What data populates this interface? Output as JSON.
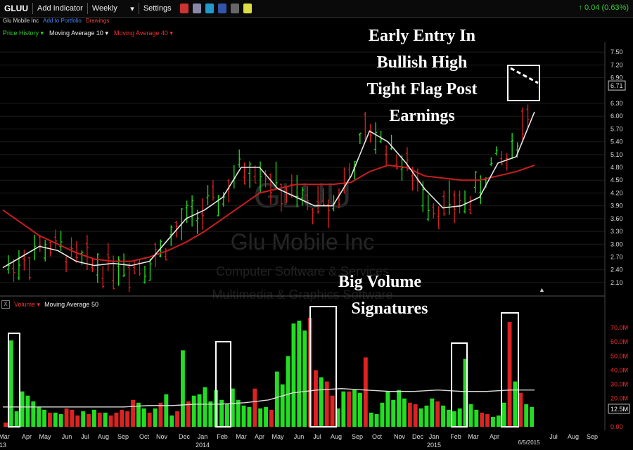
{
  "toolbar": {
    "symbol": "GLUU",
    "add_indicator": "Add Indicator",
    "period": "Weekly",
    "settings": "Settings",
    "change": "0.04 (0.63%)",
    "up_arrow": "↑"
  },
  "subbar": {
    "company": "Glu Mobile Inc",
    "add_portfolio": "Add to Portfolio",
    "drawings": "Drawings"
  },
  "price_legend": {
    "price_history": "Price History",
    "ma10": "Moving Average 10",
    "ma40": "Moving Average 40"
  },
  "volume_legend": {
    "close": "X",
    "volume": "Volume",
    "ma50": "Moving Average 50"
  },
  "watermark": {
    "symbol": "GLUU",
    "name": "Glu Mobile Inc",
    "sector": "Computer Software & Services",
    "industry": "Multimedia & Graphics Software"
  },
  "annotations": {
    "entry_line1": "Early Entry In",
    "entry_line2": "Bullish High",
    "entry_line3": "Tight Flag Post",
    "entry_line4": "Earnings",
    "volume_line1": "Big Volume",
    "volume_line2": "Signatures"
  },
  "colors": {
    "up": "#22dd22",
    "down": "#dd2222",
    "ma10": "#e6e6e6",
    "ma40": "#c81e1e",
    "accent_green": "#33cc33"
  },
  "chart_data": [
    {
      "type": "line",
      "title": "",
      "series": [
        {
          "name": "Moving Average 10",
          "values": [
            2.45,
            2.7,
            2.95,
            2.85,
            2.6,
            2.5,
            2.55,
            2.5,
            2.6,
            3.1,
            3.6,
            3.8,
            4.1,
            4.8,
            4.8,
            4.3,
            4.1,
            3.9,
            3.9,
            4.6,
            5.65,
            5.4,
            4.9,
            4.3,
            3.85,
            3.9,
            4.1,
            4.9,
            5.05,
            6.1
          ]
        },
        {
          "name": "Moving Average 40",
          "values": [
            3.8,
            3.5,
            3.2,
            3.0,
            2.8,
            2.65,
            2.6,
            2.6,
            2.7,
            2.85,
            3.05,
            3.3,
            3.6,
            3.9,
            4.2,
            4.3,
            4.4,
            4.4,
            4.4,
            4.45,
            4.7,
            4.85,
            4.8,
            4.6,
            4.55,
            4.5,
            4.5,
            4.6,
            4.7,
            4.85
          ]
        }
      ],
      "ylim": [
        2.0,
        7.7
      ],
      "yticks": [
        "7.50",
        "7.20",
        "6.90",
        "6.71",
        "6.30",
        "6.00",
        "5.70",
        "5.40",
        "5.10",
        "4.80",
        "4.50",
        "4.20",
        "3.90",
        "3.60",
        "3.30",
        "3.00",
        "2.70",
        "2.40",
        "2.10"
      ]
    },
    {
      "type": "bar",
      "title": "",
      "series": [
        {
          "name": "Volume",
          "values": [
            3,
            61,
            11,
            25,
            22,
            18,
            14,
            12,
            10,
            10,
            9,
            13,
            12,
            8,
            11,
            9,
            12,
            10,
            10,
            8,
            10,
            12,
            11,
            19,
            17,
            13,
            10,
            13,
            17,
            23,
            8,
            11,
            54,
            18,
            22,
            23,
            28,
            18,
            26,
            19,
            16,
            27,
            19,
            15,
            14,
            27,
            13,
            14,
            12,
            39,
            30,
            50,
            73,
            75,
            68,
            77,
            40,
            35,
            32,
            22,
            13,
            25,
            25,
            26,
            24,
            49,
            10,
            9,
            17,
            25,
            19,
            26,
            20,
            17,
            16,
            13,
            15,
            20,
            18,
            15,
            12,
            11,
            13,
            48,
            16,
            12,
            10,
            9,
            7,
            8,
            17,
            74,
            32,
            24,
            16,
            14
          ]
        },
        {
          "name": "Moving Average 50",
          "values": [
            14,
            14,
            14,
            14,
            14,
            14,
            15,
            15,
            16,
            16,
            17,
            19,
            24,
            26,
            27,
            26,
            25,
            25,
            26,
            25,
            25,
            26,
            26
          ]
        }
      ],
      "ylim": [
        0,
        78
      ],
      "yticks": [
        "70.0M",
        "60.0M",
        "50.0M",
        "40.0M",
        "30.0M",
        "20.0M",
        "12.5M",
        "0.00"
      ]
    }
  ],
  "x_axis": {
    "labels": [
      "Mar",
      "Apr",
      "May",
      "Jun",
      "Jul",
      "Aug",
      "Sep",
      "Oct",
      "Nov",
      "Dec",
      "Jan",
      "Feb",
      "Mar",
      "Apr",
      "May",
      "Jun",
      "Jul",
      "Aug",
      "Sep",
      "Oct",
      "Nov",
      "Dec",
      "Jan",
      "Feb",
      "Mar",
      "Apr",
      "Jul",
      "Aug",
      "Sep"
    ],
    "years": [
      "13",
      "2014",
      "2015"
    ],
    "date_label": "6/5/2015"
  }
}
